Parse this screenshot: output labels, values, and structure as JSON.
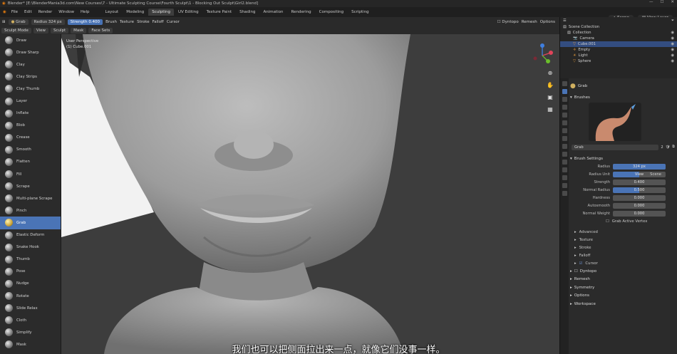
{
  "window": {
    "title": "Blender* [E:\\BlenderMania3d.com\\New Courses\\7 - Ultimate Sculpting Course\\Fourth Sculpt\\1 - Blocking Out Sculpt\\Girl2.blend]"
  },
  "topbar": {
    "menu": [
      "File",
      "Edit",
      "Render",
      "Window",
      "Help"
    ],
    "workspaces": [
      "Layout",
      "Modeling",
      "Sculpting",
      "UV Editing",
      "Texture Paint",
      "Shading",
      "Animation",
      "Rendering",
      "Compositing",
      "Scripting"
    ],
    "active_workspace": "Sculpting",
    "scene": "Scene",
    "view_layer": "View Layer"
  },
  "tool_header": {
    "brush_name": "Grab",
    "radius_label": "Radius",
    "radius_value": "324 px",
    "strength_label": "Strength",
    "strength_value": "0.400",
    "brush_menu": "Brush",
    "texture_menu": "Texture",
    "stroke_menu": "Stroke",
    "falloff_menu": "Falloff",
    "cursor_menu": "Cursor",
    "dyntopo": "Dyntopo",
    "remesh": "Remesh",
    "options": "Options"
  },
  "modebar": {
    "mode": "Sculpt Mode",
    "items": [
      "View",
      "Sculpt",
      "Mask",
      "Face Sets"
    ]
  },
  "tools": [
    "Draw",
    "Draw Sharp",
    "Clay",
    "Clay Strips",
    "Clay Thumb",
    "Layer",
    "Inflate",
    "Blob",
    "Crease",
    "Smooth",
    "Flatten",
    "Fill",
    "Scrape",
    "Multi-plane Scrape",
    "Pinch",
    "Grab",
    "Elastic Deform",
    "Snake Hook",
    "Thumb",
    "Pose",
    "Nudge",
    "Rotate",
    "Slide Relax",
    "Cloth",
    "Simplify",
    "Mask"
  ],
  "active_tool": "Grab",
  "viewport": {
    "perspective": "User Perspective",
    "object": "(1) Cube.001"
  },
  "subtitle": "我们也可以把侧面拉出来一点，就像它们没事一样。",
  "outliner": {
    "root": "Scene Collection",
    "items": [
      {
        "name": "Collection",
        "selected": false
      },
      {
        "name": "Camera",
        "selected": false
      },
      {
        "name": "Cube.001",
        "selected": true
      },
      {
        "name": "Empty",
        "selected": false
      },
      {
        "name": "Light",
        "selected": false
      },
      {
        "name": "Sphere",
        "selected": false
      }
    ]
  },
  "properties": {
    "tool_name": "Grab",
    "brushes_label": "Brushes",
    "brush_field": "Grab",
    "brush_users": "2",
    "brush_settings_label": "Brush Settings",
    "rows": [
      {
        "label": "Radius",
        "value": "324 px",
        "fill": 1.0
      },
      {
        "label": "Radius Unit",
        "value": "View",
        "value2": "Scene",
        "fill": 0.5
      },
      {
        "label": "Strength",
        "value": "0.400",
        "fill": 0.0
      },
      {
        "label": "Normal Radius",
        "value": "0.500",
        "fill": 0.5
      },
      {
        "label": "Hardness",
        "value": "0.000",
        "fill": 0.0
      },
      {
        "label": "Autosmooth",
        "value": "0.000",
        "fill": 0.0
      },
      {
        "label": "Normal Weight",
        "value": "0.000",
        "fill": 0.0
      }
    ],
    "grab_active_vertex": "Grab Active Vertex",
    "subpanels": [
      "Advanced",
      "Texture",
      "Stroke",
      "Falloff",
      "Cursor"
    ],
    "sections": [
      "Dyntopo",
      "Remesh",
      "Symmetry",
      "Options",
      "Workspace"
    ]
  },
  "colors": {
    "accent": "#4a74b6",
    "viewport_bg": "#3d3d3d",
    "sculpt_mesh": "#a8a8a8"
  }
}
